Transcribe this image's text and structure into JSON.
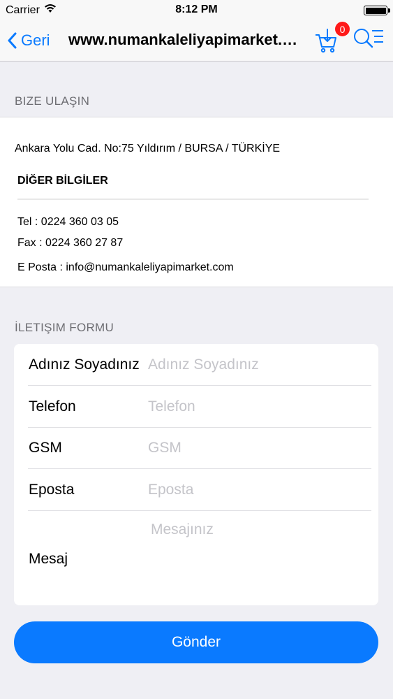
{
  "status_bar": {
    "carrier": "Carrier",
    "time": "8:12 PM"
  },
  "nav": {
    "back_label": "Geri",
    "title": "www.numankaleliyapimarket.com",
    "cart_count": "0",
    "accent_color": "#0a7aff",
    "badge_color": "#ff1a1a",
    "icons": [
      "chevron-left-icon",
      "cart-download-icon",
      "search-menu-icon"
    ]
  },
  "contact": {
    "section_title": "BIZE ULAŞIN",
    "address": "Ankara Yolu Cad. No:75 Yıldırım / BURSA / TÜRKİYE",
    "other_title": "DİĞER BİLGİLER",
    "tel": "Tel : 0224 360 03 05",
    "fax": "Fax : 0224 360 27 87",
    "email": "E Posta : info@numankaleliyapimarket.com"
  },
  "form": {
    "section_title": "İLETIŞIM FORMU",
    "fields": [
      {
        "label": "Adınız Soyadınız",
        "placeholder": "Adınız Soyadınız",
        "value": ""
      },
      {
        "label": "Telefon",
        "placeholder": "Telefon",
        "value": ""
      },
      {
        "label": "GSM",
        "placeholder": "GSM",
        "value": ""
      },
      {
        "label": "Eposta",
        "placeholder": "Eposta",
        "value": ""
      }
    ],
    "message": {
      "label": "Mesaj",
      "placeholder": "Mesajınız",
      "value": ""
    },
    "submit_label": "Gönder"
  }
}
